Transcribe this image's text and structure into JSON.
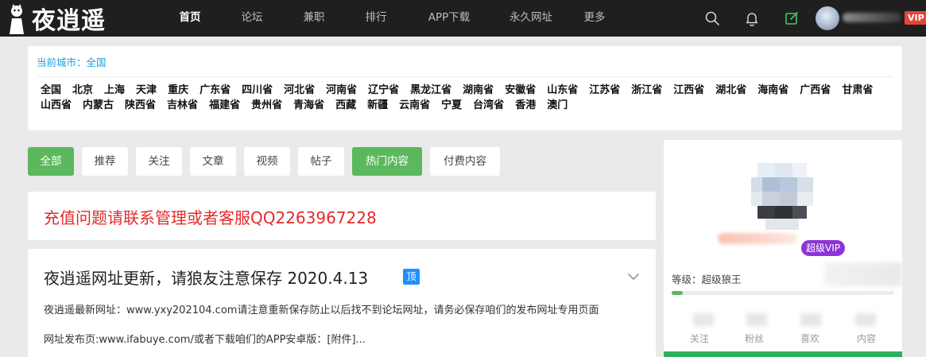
{
  "brand": {
    "logo_text": "夜逍遥"
  },
  "nav": {
    "items": [
      {
        "label": "首页",
        "active": true
      },
      {
        "label": "论坛",
        "active": false
      },
      {
        "label": "兼职",
        "active": false
      },
      {
        "label": "排行",
        "active": false
      },
      {
        "label": "APP下载",
        "active": false
      },
      {
        "label": "永久网址",
        "active": false
      },
      {
        "label": "更多",
        "active": false
      }
    ],
    "icons": [
      "search-icon",
      "bell-icon",
      "edit-icon"
    ],
    "vip_label": "VIP"
  },
  "city": {
    "current_label": "当前城市：全国",
    "list": [
      "全国",
      "北京",
      "上海",
      "天津",
      "重庆",
      "广东省",
      "四川省",
      "河北省",
      "河南省",
      "辽宁省",
      "黑龙江省",
      "湖南省",
      "安徽省",
      "山东省",
      "江苏省",
      "浙江省",
      "江西省",
      "湖北省",
      "海南省",
      "广西省",
      "甘肃省",
      "山西省",
      "内蒙古",
      "陕西省",
      "吉林省",
      "福建省",
      "贵州省",
      "青海省",
      "西藏",
      "新疆",
      "云南省",
      "宁夏",
      "台湾省",
      "香港",
      "澳门"
    ]
  },
  "tabs": [
    {
      "label": "全部",
      "style": "green"
    },
    {
      "label": "推荐",
      "style": "white"
    },
    {
      "label": "关注",
      "style": "white"
    },
    {
      "label": "文章",
      "style": "white"
    },
    {
      "label": "视频",
      "style": "white"
    },
    {
      "label": "帖子",
      "style": "white"
    },
    {
      "label": "热门内容",
      "style": "green"
    },
    {
      "label": "付费内容",
      "style": "white"
    }
  ],
  "notice": {
    "text": "充值问题请联系管理或者客服QQ2263967228"
  },
  "post": {
    "title": "夜逍遥网址更新，请狼友注意保存 2020.4.13",
    "pin_label": "顶",
    "lines": [
      "夜逍遥最新网址：www.yxy202104.com请注意重新保存防止以后找不到论坛网址，请务必保存咱们的发布网址专用页面",
      "网址发布页:www.ifabuye.com/或者下载咱们的APP安卓版：[附件]..."
    ]
  },
  "user": {
    "svip_label": "超级VIP",
    "level_label": "等级：超级狼王",
    "level_progress": 0.05,
    "stats": [
      "关注",
      "粉丝",
      "喜欢",
      "内容"
    ]
  },
  "colors": {
    "accent_green": "#5cb85c",
    "notice_red": "#e42a2a",
    "vip_red": "#e8433a",
    "svip_purple": "#8b35d8",
    "pin_blue": "#1e90ff",
    "city_blue": "#1aa2d8"
  }
}
